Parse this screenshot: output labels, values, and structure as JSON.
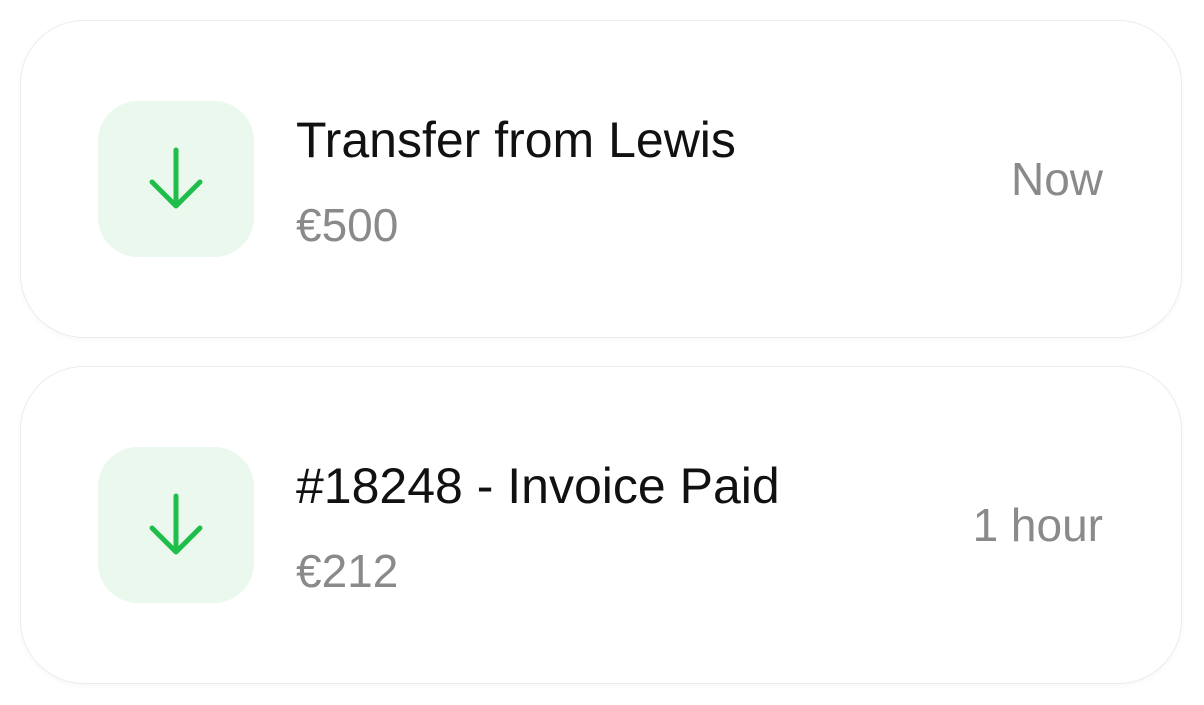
{
  "colors": {
    "icon_bg": "#eaf8ee",
    "icon_arrow": "#1fbe4a",
    "muted_text": "#8a8a8a",
    "primary_text": "#111111",
    "card_border": "#ececec"
  },
  "notifications": [
    {
      "icon": "arrow-down-icon",
      "title": "Transfer from Lewis",
      "amount": "€500",
      "time": "Now"
    },
    {
      "icon": "arrow-down-icon",
      "title": "#18248 - Invoice Paid",
      "amount": "€212",
      "time": "1 hour"
    }
  ]
}
